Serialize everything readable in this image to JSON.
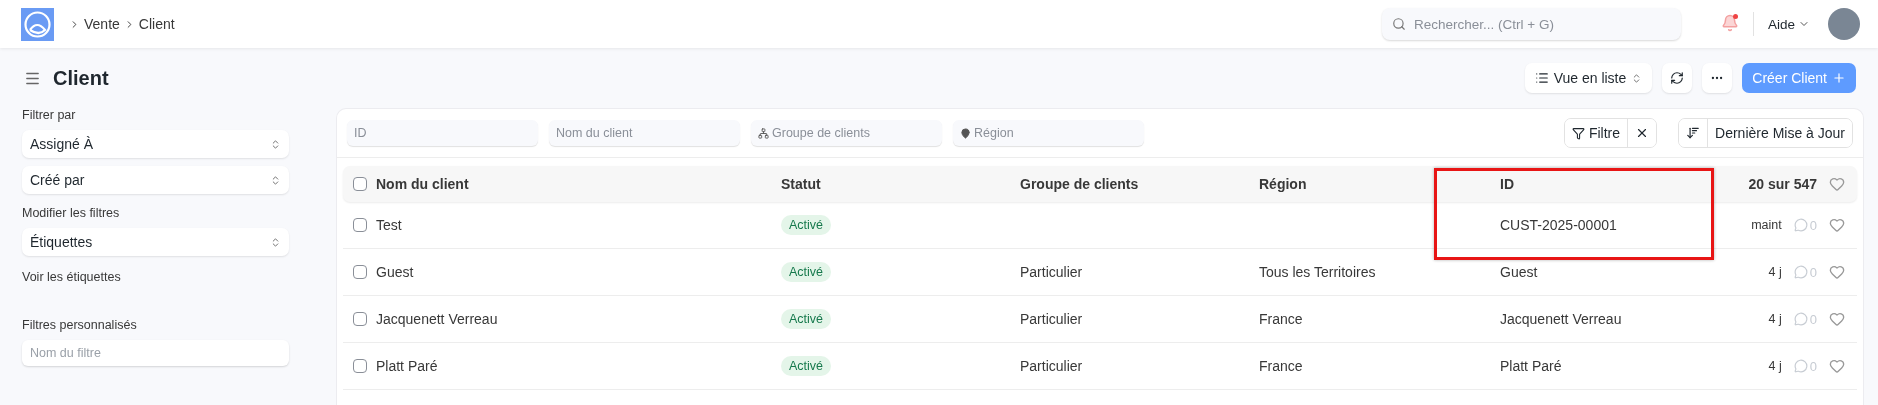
{
  "topbar": {
    "breadcrumbs": [
      "Vente",
      "Client"
    ],
    "search": {
      "placeholder": "Rechercher... (Ctrl + G)"
    },
    "notifications": {
      "unread": true
    },
    "help": "Aide"
  },
  "page": {
    "title": "Client",
    "view_selector": "Vue en liste",
    "create_button": "Créer Client"
  },
  "sidebar": {
    "filter_label": "Filtrer par",
    "selects": [
      {
        "label": "Assigné À"
      },
      {
        "label": "Créé par"
      }
    ],
    "edit_filters": "Modifier les filtres",
    "tags_select": "Étiquettes",
    "show_tags": "Voir les étiquettes",
    "custom_filters_label": "Filtres personnalisés",
    "custom_filter": {
      "placeholder": "Nom du filtre"
    }
  },
  "filters": [
    {
      "placeholder": "ID"
    },
    {
      "placeholder": "Nom du client"
    },
    {
      "placeholder": "Groupe de clients"
    },
    {
      "placeholder": "Région"
    }
  ],
  "filter_button": "Filtre",
  "sort_button": "Dernière Mise à Jour",
  "table": {
    "all_checked": false,
    "columns": [
      {
        "label": "Nom du client",
        "highlighted": false
      },
      {
        "label": "Statut",
        "highlighted": false
      },
      {
        "label": "Groupe de clients",
        "highlighted": false
      },
      {
        "label": "Région",
        "highlighted": false
      },
      {
        "label": "ID",
        "highlighted": true
      }
    ],
    "count": "20 sur 547",
    "rows": [
      {
        "checked": false,
        "name": "Test",
        "status": {
          "label": "Activé",
          "kind": "success"
        },
        "group": "",
        "region": "",
        "id": "CUST-2025-00001",
        "modified": "maint",
        "comments": "0",
        "liked": false
      },
      {
        "checked": false,
        "name": "Guest",
        "status": {
          "label": "Activé",
          "kind": "success"
        },
        "group": "Particulier",
        "region": "Tous les Territoires",
        "id": "Guest",
        "modified": "4 j",
        "comments": "0",
        "liked": false
      },
      {
        "checked": false,
        "name": "Jacquenett Verreau",
        "status": {
          "label": "Activé",
          "kind": "success"
        },
        "group": "Particulier",
        "region": "France",
        "id": "Jacquenett Verreau",
        "modified": "4 j",
        "comments": "0",
        "liked": false
      },
      {
        "checked": false,
        "name": "Platt Paré",
        "status": {
          "label": "Activé",
          "kind": "success"
        },
        "group": "Particulier",
        "region": "France",
        "id": "Platt Paré",
        "modified": "4 j",
        "comments": "0",
        "liked": false
      }
    ]
  }
}
